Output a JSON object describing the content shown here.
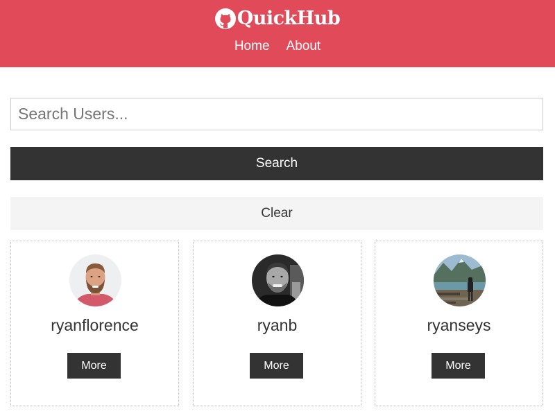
{
  "app": {
    "brand_icon": "github-icon",
    "brand_name": "QuickHub",
    "accent_color": "#e04a59"
  },
  "nav": {
    "home_label": "Home",
    "about_label": "About"
  },
  "search": {
    "placeholder": "Search Users...",
    "value": "",
    "search_label": "Search",
    "clear_label": "Clear"
  },
  "users": [
    {
      "login": "ryanflorence",
      "more_label": "More"
    },
    {
      "login": "ryanb",
      "more_label": "More"
    },
    {
      "login": "ryanseys",
      "more_label": "More"
    }
  ]
}
